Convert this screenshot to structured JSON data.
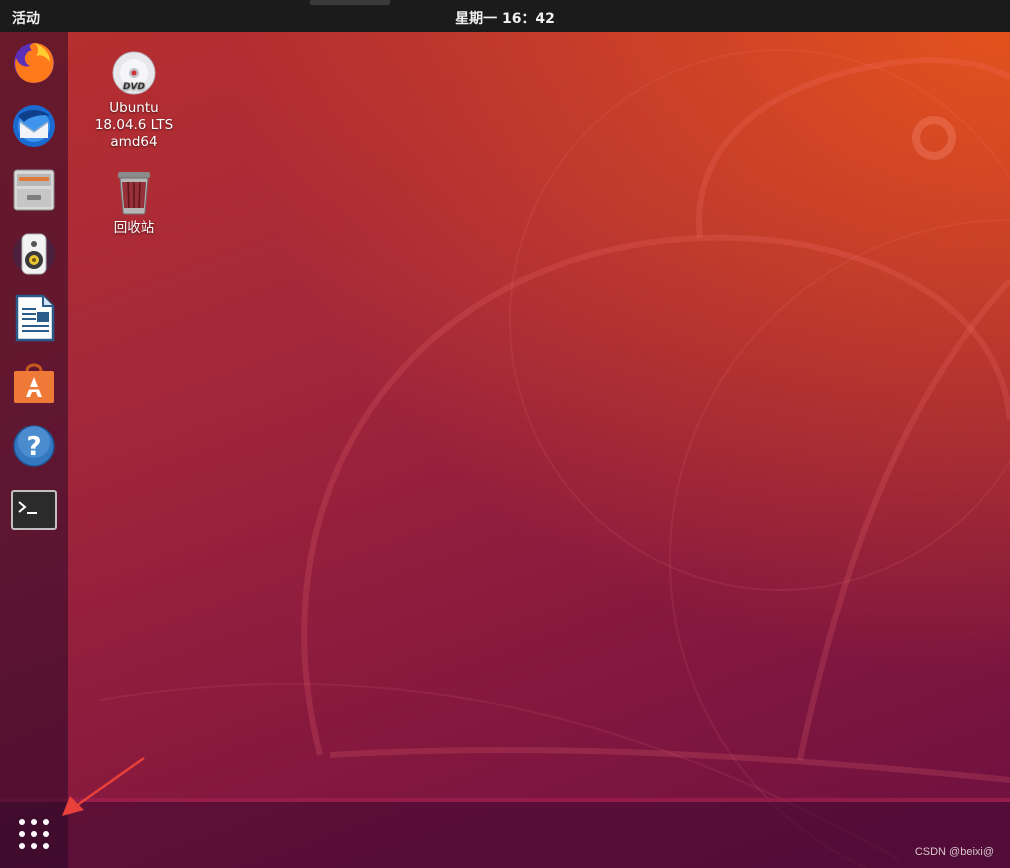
{
  "topbar": {
    "activities_label": "活动",
    "clock": "星期一 16：42"
  },
  "dock": {
    "items": [
      {
        "name": "Firefox",
        "icon": "firefox-icon"
      },
      {
        "name": "Thunderbird",
        "icon": "thunderbird-icon"
      },
      {
        "name": "Files",
        "icon": "files-icon"
      },
      {
        "name": "Rhythmbox",
        "icon": "rhythmbox-icon"
      },
      {
        "name": "LibreOffice Writer",
        "icon": "writer-icon"
      },
      {
        "name": "Ubuntu Software",
        "icon": "software-icon"
      },
      {
        "name": "Help",
        "icon": "help-icon"
      },
      {
        "name": "Terminal",
        "icon": "terminal-icon"
      }
    ],
    "show_apps_icon": "app-grid-icon"
  },
  "desktop_icons": [
    {
      "icon": "dvd-icon",
      "line1": "Ubuntu",
      "line2": "18.04.6 LTS",
      "line3": "amd64"
    },
    {
      "icon": "trash-icon",
      "line1": "回收站"
    }
  ],
  "annotation": {
    "color": "#e8403a"
  },
  "watermark": "CSDN @beixi@",
  "colors": {
    "topbar": "#1b1b1b",
    "wallpaper_orange": "#e6531c",
    "wallpaper_purple": "#6c1040"
  }
}
